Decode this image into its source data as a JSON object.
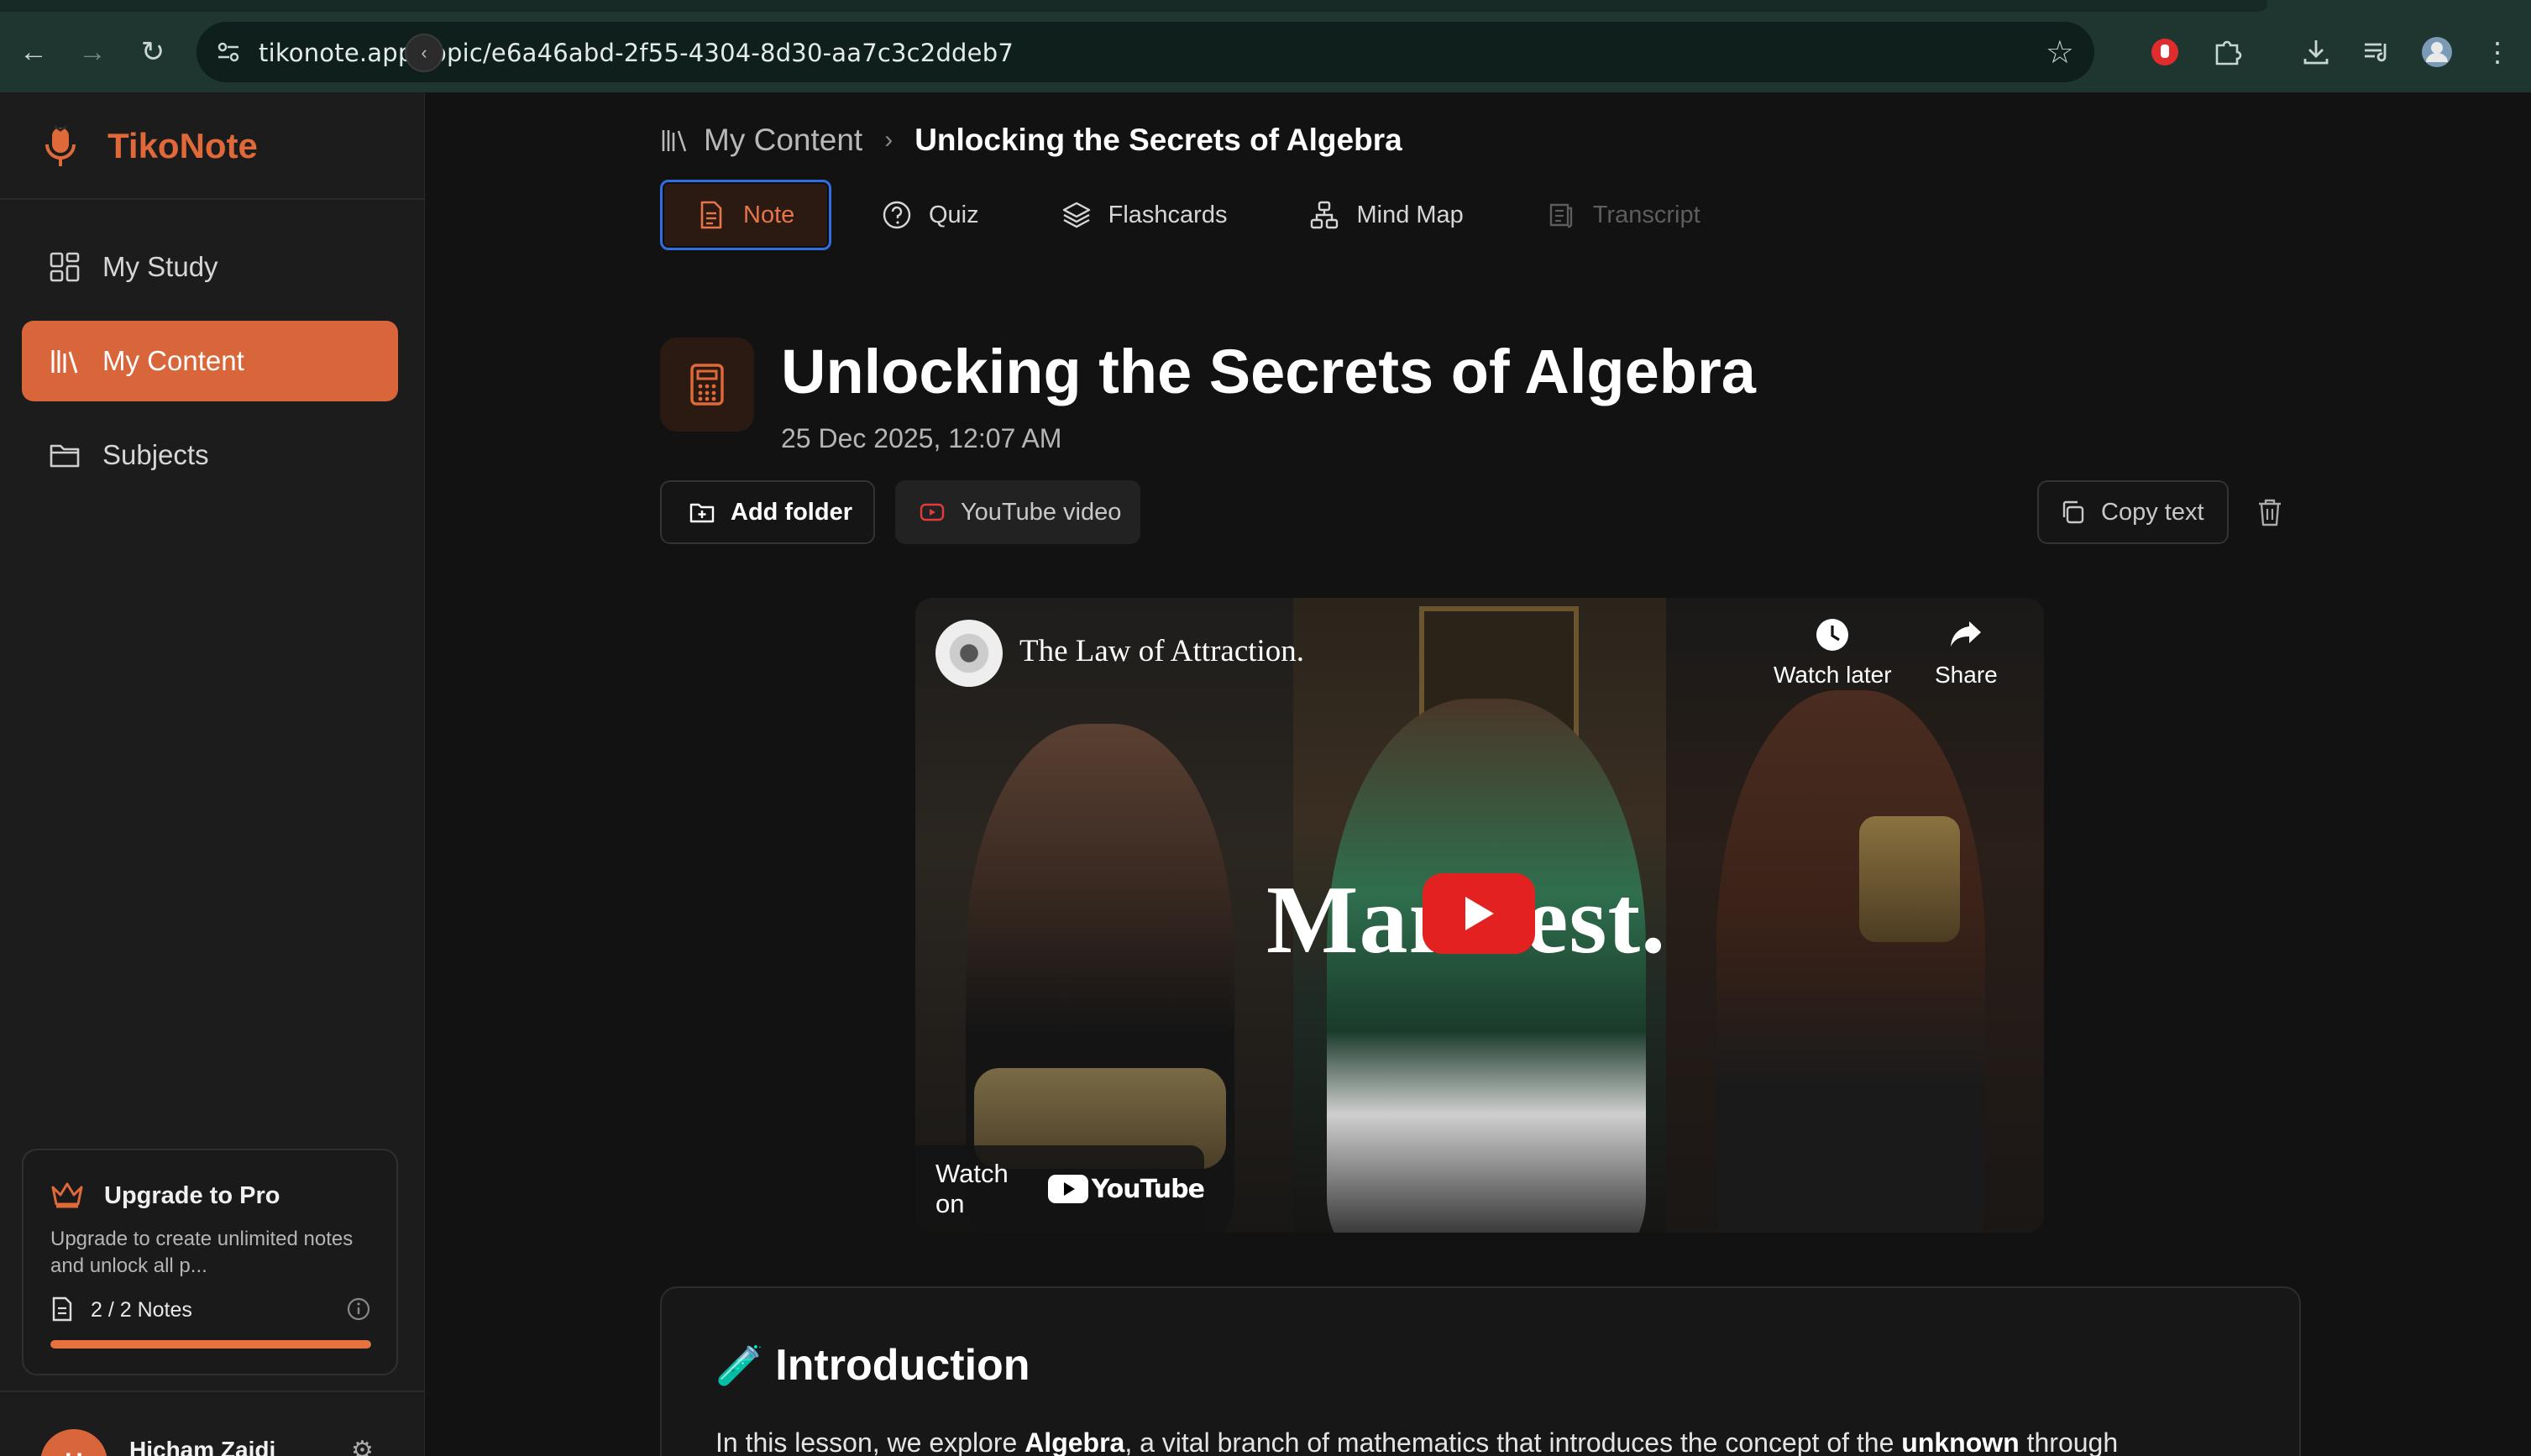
{
  "browser": {
    "url": "tikonote.app/topic/e6a46abd-2f55-4304-8d30-aa7c3c2ddeb7"
  },
  "sidebar": {
    "brand": "TikoNote",
    "items": [
      {
        "label": "My Study",
        "icon": "grid-icon"
      },
      {
        "label": "My Content",
        "icon": "library-icon",
        "active": true
      },
      {
        "label": "Subjects",
        "icon": "folder-icon"
      }
    ],
    "upgrade": {
      "title": "Upgrade to Pro",
      "description": "Upgrade to create unlimited notes and unlock all p...",
      "notes_label": "2 / 2 Notes",
      "notes_used": 2,
      "notes_limit": 2
    },
    "user": {
      "name": "Hicham Zaidi",
      "initial": "H"
    }
  },
  "breadcrumb": {
    "parent": "My Content",
    "current": "Unlocking the Secrets of Algebra"
  },
  "tabs": [
    {
      "label": "Note",
      "icon": "note-icon",
      "active": true
    },
    {
      "label": "Quiz",
      "icon": "question-icon"
    },
    {
      "label": "Flashcards",
      "icon": "layers-icon"
    },
    {
      "label": "Mind Map",
      "icon": "mindmap-icon"
    },
    {
      "label": "Transcript",
      "icon": "transcript-icon",
      "disabled": true
    }
  ],
  "page": {
    "title": "Unlocking the Secrets of Algebra",
    "date": "25 Dec 2025, 12:07 AM",
    "icon": "calculator-icon"
  },
  "actions": {
    "add_folder": "Add folder",
    "youtube": "YouTube video",
    "copy_text": "Copy text"
  },
  "video": {
    "channel_title": "The Law of Attraction.",
    "overlay_text": "Manifest.",
    "watch_later": "Watch later",
    "share": "Share",
    "watch_on": "Watch on",
    "youtube_brand": "YouTube"
  },
  "note": {
    "heading_emoji": "🧪",
    "heading": "Introduction",
    "paragraph_start": "In this lesson, we explore ",
    "paragraph_bold1": "Algebra",
    "paragraph_mid": ", a vital branch of mathematics that introduces the concept of the ",
    "paragraph_bold2": "unknown",
    "paragraph_end": " through"
  },
  "colors": {
    "accent": "#d9663b",
    "focus_ring": "#2f6ee0",
    "youtube_red": "#e32121"
  }
}
